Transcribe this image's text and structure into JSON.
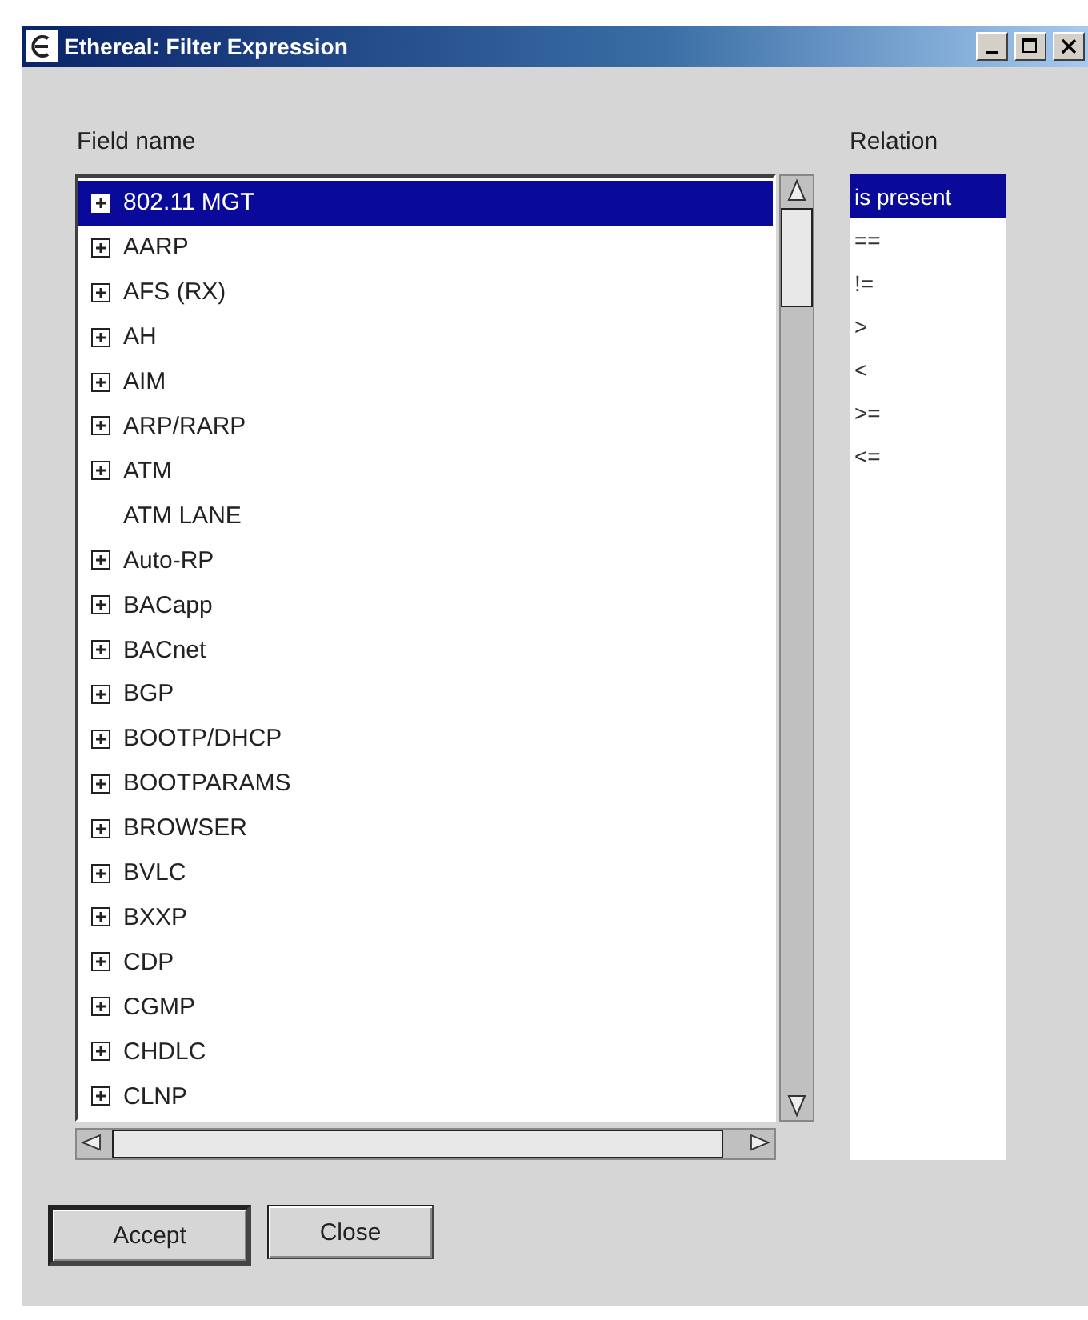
{
  "window": {
    "title": "Ethereal: Filter Expression"
  },
  "field_name": {
    "label": "Field name",
    "items": [
      {
        "name": "802.11 MGT",
        "expandable": true,
        "selected": true
      },
      {
        "name": "AARP",
        "expandable": true,
        "selected": false
      },
      {
        "name": "AFS (RX)",
        "expandable": true,
        "selected": false
      },
      {
        "name": "AH",
        "expandable": true,
        "selected": false
      },
      {
        "name": "AIM",
        "expandable": true,
        "selected": false
      },
      {
        "name": "ARP/RARP",
        "expandable": true,
        "selected": false
      },
      {
        "name": "ATM",
        "expandable": true,
        "selected": false
      },
      {
        "name": "ATM LANE",
        "expandable": false,
        "selected": false
      },
      {
        "name": "Auto-RP",
        "expandable": true,
        "selected": false
      },
      {
        "name": "BACapp",
        "expandable": true,
        "selected": false
      },
      {
        "name": "BACnet",
        "expandable": true,
        "selected": false
      },
      {
        "name": "BGP",
        "expandable": true,
        "selected": false
      },
      {
        "name": "BOOTP/DHCP",
        "expandable": true,
        "selected": false
      },
      {
        "name": "BOOTPARAMS",
        "expandable": true,
        "selected": false
      },
      {
        "name": "BROWSER",
        "expandable": true,
        "selected": false
      },
      {
        "name": "BVLC",
        "expandable": true,
        "selected": false
      },
      {
        "name": "BXXP",
        "expandable": true,
        "selected": false
      },
      {
        "name": "CDP",
        "expandable": true,
        "selected": false
      },
      {
        "name": "CGMP",
        "expandable": true,
        "selected": false
      },
      {
        "name": "CHDLC",
        "expandable": true,
        "selected": false
      },
      {
        "name": "CLNP",
        "expandable": true,
        "selected": false
      }
    ]
  },
  "relation": {
    "label": "Relation",
    "items": [
      {
        "name": "is present",
        "selected": true
      },
      {
        "name": "==",
        "selected": false
      },
      {
        "name": "!=",
        "selected": false
      },
      {
        "name": ">",
        "selected": false
      },
      {
        "name": "<",
        "selected": false
      },
      {
        "name": ">=",
        "selected": false
      },
      {
        "name": "<=",
        "selected": false
      }
    ]
  },
  "buttons": [
    {
      "label": "Accept",
      "default": true
    },
    {
      "label": "Close",
      "default": false
    }
  ]
}
